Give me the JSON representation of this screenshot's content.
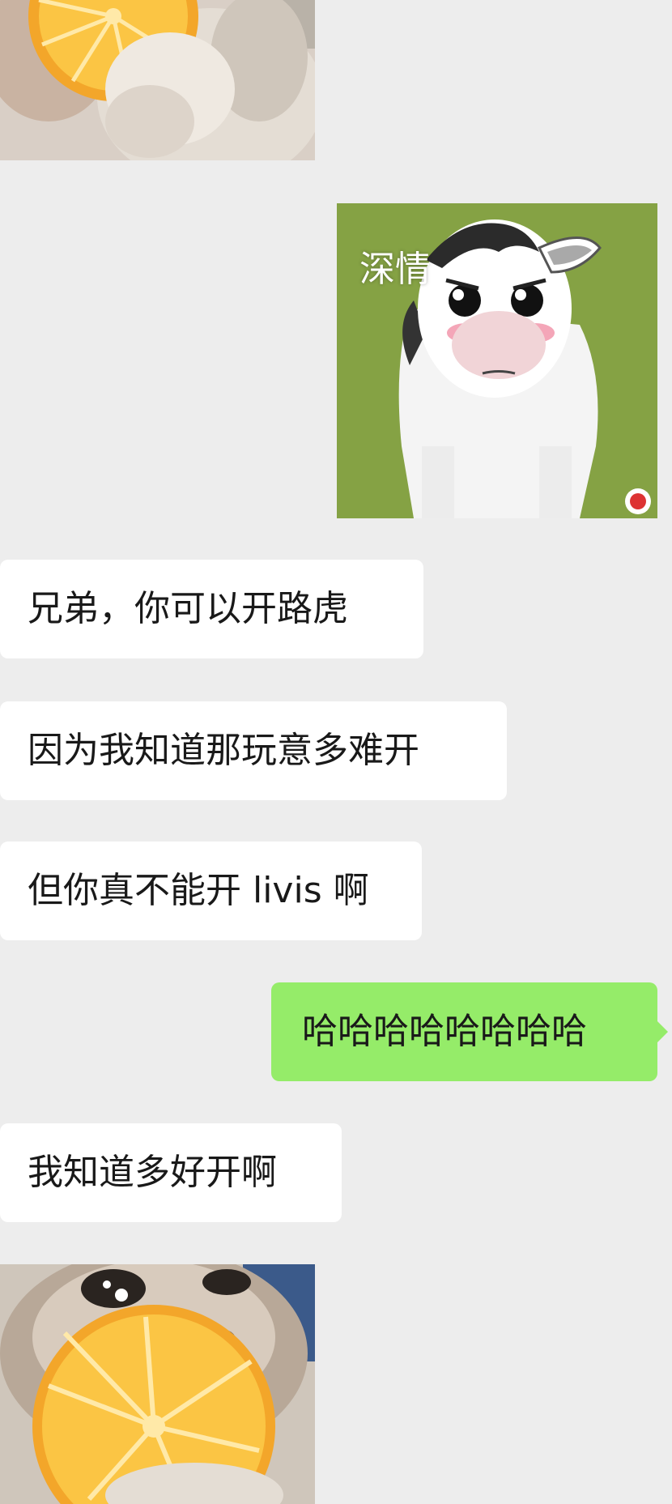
{
  "chat": {
    "stickers": [
      {
        "name": "crying-cat-orange-sticker"
      },
      {
        "name": "cow-sticker",
        "caption": "深情"
      },
      {
        "name": "crying-cat-orange-sticker"
      }
    ],
    "messages": [
      {
        "side": "received",
        "text": "兄弟，你可以开路虎"
      },
      {
        "side": "received",
        "text": "因为我知道那玩意多难开"
      },
      {
        "side": "received",
        "text": "但你真不能开 livis 啊"
      },
      {
        "side": "sent",
        "text": "哈哈哈哈哈哈哈哈"
      },
      {
        "side": "received",
        "text": "我知道多好开啊"
      }
    ]
  },
  "colors": {
    "background": "#ededed",
    "received_bubble": "#ffffff",
    "sent_bubble": "#95ec69"
  }
}
